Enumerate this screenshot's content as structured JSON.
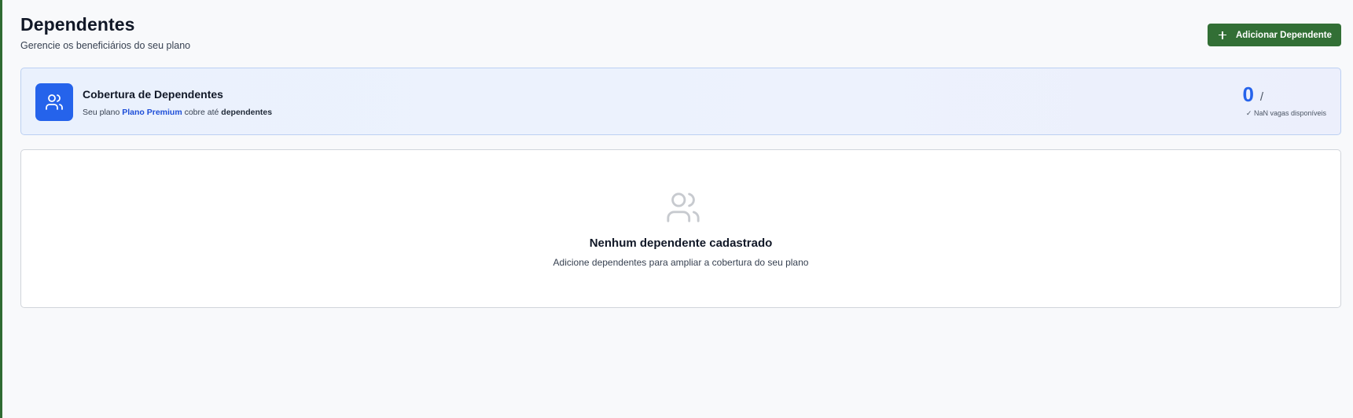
{
  "page": {
    "title": "Dependentes",
    "subtitle": "Gerencie os beneficiários do seu plano",
    "add_button_label": "Adicionar Dependente"
  },
  "coverage": {
    "title": "Cobertura de Dependentes",
    "desc_prefix": "Seu plano ",
    "plan_name": "Plano Premium",
    "desc_middle": " cobre até ",
    "desc_suffix": "dependentes",
    "count": "0",
    "count_separator": "/",
    "vacancy_text": "✓ NaN vagas disponíveis",
    "icon": "users-icon"
  },
  "empty_state": {
    "icon": "users-icon",
    "title": "Nenhum dependente cadastrado",
    "description": "Adicione dependentes para ampliar a cobertura do seu plano"
  },
  "colors": {
    "accent_green": "#326f35",
    "accent_blue": "#2563eb",
    "plan_link_blue": "#1d4ed8"
  }
}
